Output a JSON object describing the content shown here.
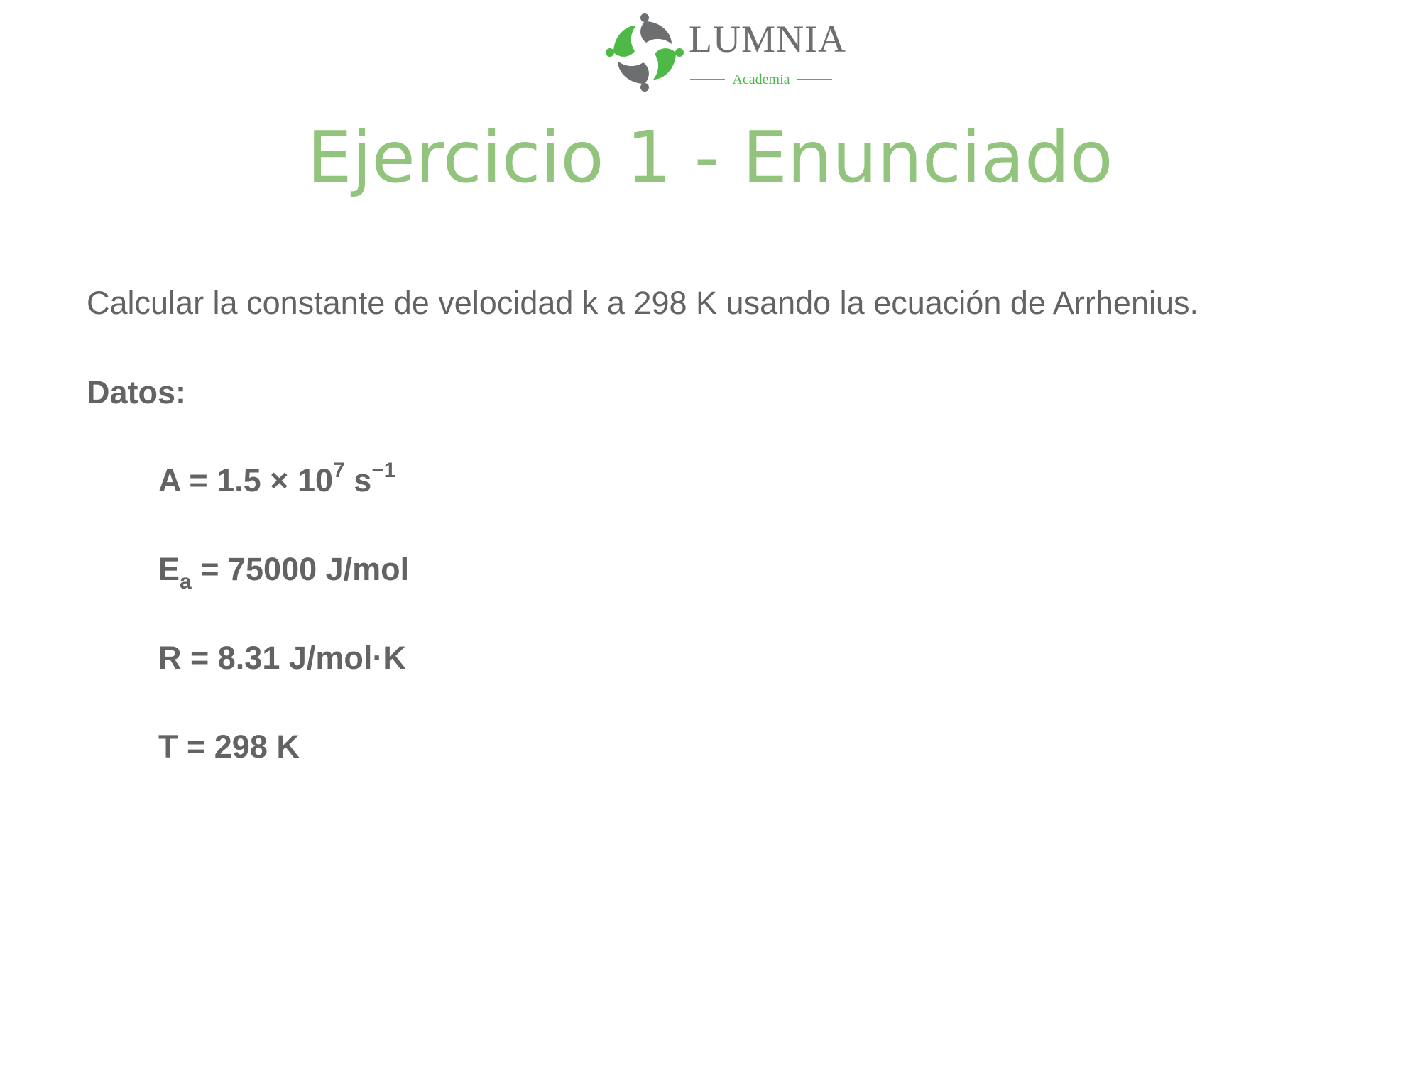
{
  "logo": {
    "name": "LUMNIA",
    "subtitle": "Academia",
    "colors": {
      "green": "#4fb948",
      "gray": "#6d6e70"
    }
  },
  "title": "Ejercicio 1 - Enunciado",
  "statement": "Calcular la constante de velocidad k a 298 K usando la ecuación de Arrhenius.",
  "datos_label": "Datos:",
  "data": {
    "A": {
      "prefix": "A = 1.5 × 10",
      "exp": "7",
      "unit": " s",
      "unit_exp": "−1"
    },
    "Ea": {
      "symbol": "E",
      "sub": "a",
      "rest": " = 75000 J/mol"
    },
    "R": {
      "text": "R = 8.31 J/mol·K"
    },
    "T": {
      "text": "T = 298 K"
    }
  },
  "colors": {
    "title": "#93c47d",
    "text": "#636363",
    "background": "#ffffff"
  }
}
